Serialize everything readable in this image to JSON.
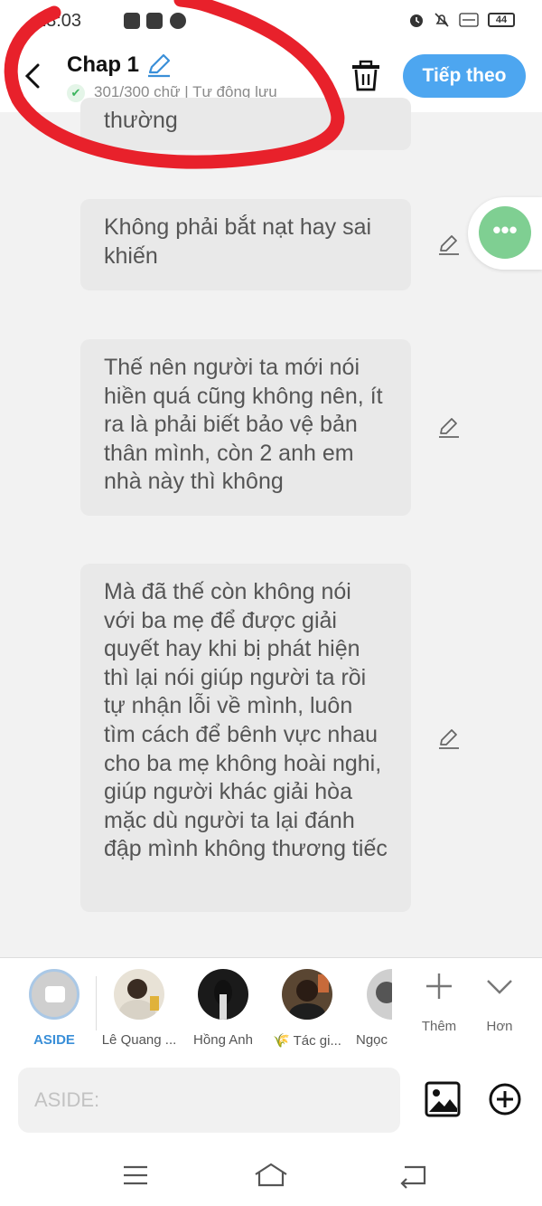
{
  "status_bar": {
    "time": "13:03",
    "battery": "44"
  },
  "header": {
    "title": "Chap 1",
    "subtitle": "301/300 chữ | Tự động lưu",
    "next_label": "Tiếp theo"
  },
  "messages": [
    {
      "text": "thường"
    },
    {
      "text": "Không phải bắt nạt hay sai khiến"
    },
    {
      "text": "Thế nên người ta mới nói hiền quá cũng không nên, ít ra là phải biết bảo vệ bản thân mình, còn 2 anh em nhà này thì không"
    },
    {
      "text": "Mà đã thế còn không nói với ba mẹ để được giải quyết hay khi bị phát hiện thì lại nói giúp người ta rồi tự nhận lỗi về mình, luôn tìm cách để bênh vực nhau cho ba mẹ không hoài nghi, giúp người khác giải hòa mặc dù người ta lại đánh đập mình không thương tiếc"
    }
  ],
  "fab": {
    "label": "•••"
  },
  "characters": [
    {
      "name": "ASIDE"
    },
    {
      "name": "Lê Quang ..."
    },
    {
      "name": "Hồng Anh"
    },
    {
      "name": "🌾 Tác gi..."
    },
    {
      "name": "Ngọc"
    }
  ],
  "tools": {
    "add_label": "Thêm",
    "more_label": "Hơn"
  },
  "input": {
    "placeholder": "ASIDE:"
  },
  "colors": {
    "accent": "#4da6f0",
    "fab": "#7fcf92",
    "annotation": "#e8212b"
  }
}
